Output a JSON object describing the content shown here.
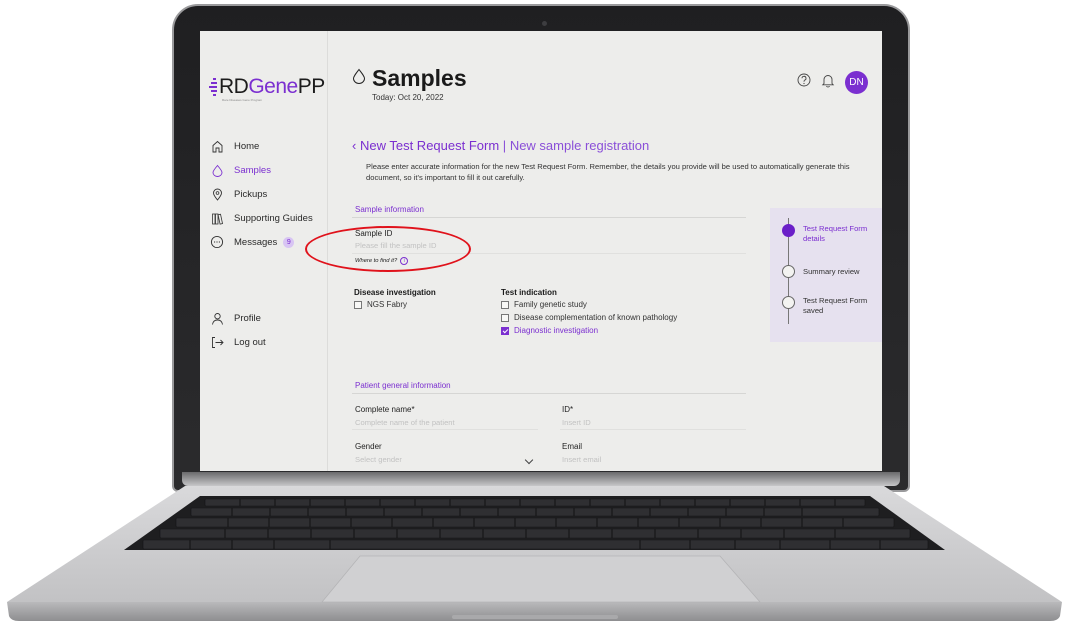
{
  "app": {
    "logo_prefix": "RD",
    "logo_gene": "Gene",
    "logo_suffix": "PP",
    "logo_tagline": "Rare Diseases Gene Program"
  },
  "sidebar": {
    "items": [
      {
        "label": "Home",
        "icon": "home-icon"
      },
      {
        "label": "Samples",
        "icon": "drop-icon",
        "active": true
      },
      {
        "label": "Pickups",
        "icon": "location-pin-icon"
      },
      {
        "label": "Supporting Guides",
        "icon": "books-icon"
      },
      {
        "label": "Messages",
        "icon": "chat-icon",
        "badge": "9"
      }
    ],
    "bottom_items": [
      {
        "label": "Profile",
        "icon": "user-icon"
      },
      {
        "label": "Log out",
        "icon": "logout-icon"
      }
    ]
  },
  "header": {
    "title": "Samples",
    "date": "Today: Oct 20, 2022",
    "avatar_initials": "DN"
  },
  "form": {
    "breadcrumb_main": "New Test Request Form",
    "breadcrumb_sep": "|",
    "breadcrumb_sub": "New sample registration",
    "intro": "Please enter accurate information for the new Test Request Form. Remember, the details you provide will be used to automatically generate this document, so it's important to fill it out carefully.",
    "sample_section": "Sample information",
    "sample_id_label": "Sample ID",
    "sample_id_placeholder": "Please fill the sample ID",
    "help_link": "Where to find it?",
    "disease_title": "Disease investigation",
    "disease_options": [
      {
        "label": "NGS Fabry",
        "checked": false
      }
    ],
    "indication_title": "Test indication",
    "indication_options": [
      {
        "label": "Family genetic study",
        "checked": false
      },
      {
        "label": "Disease complementation of known pathology",
        "checked": false
      },
      {
        "label": "Diagnostic investigation",
        "checked": true
      }
    ],
    "patient_section": "Patient general information",
    "name_label": "Complete name*",
    "name_placeholder": "Complete name of the patient",
    "id_label": "ID*",
    "id_placeholder": "Insert ID",
    "gender_label": "Gender",
    "gender_placeholder": "Select gender",
    "email_label": "Email",
    "email_placeholder": "Insert email"
  },
  "stepper": [
    {
      "label": "Test Request Form details",
      "active": true
    },
    {
      "label": "Summary review",
      "active": false
    },
    {
      "label": "Test Request Form saved",
      "active": false
    }
  ],
  "colors": {
    "accent": "#7b2fd0",
    "annotation": "#e0121b",
    "screen_bg": "#ededeb"
  }
}
